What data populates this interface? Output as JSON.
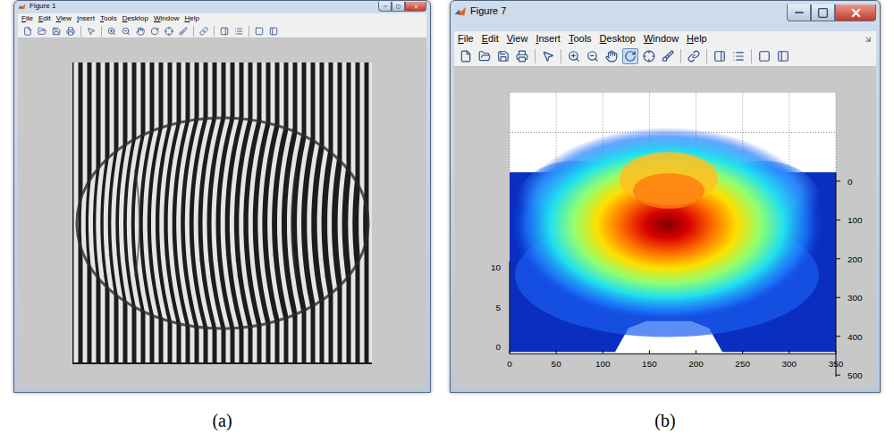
{
  "windows": [
    {
      "title": "Figure 1",
      "menu": [
        "File",
        "Edit",
        "View",
        "Insert",
        "Tools",
        "Desktop",
        "Window",
        "Help"
      ],
      "toolbar": [
        {
          "selected": false
        },
        {
          "selected": false
        },
        {
          "selected": false
        },
        {
          "selected": false
        },
        {
          "selected": false
        },
        {
          "selected": false
        },
        {
          "selected": false
        },
        {
          "selected": false
        },
        {
          "selected": false
        },
        {
          "selected": false
        },
        {
          "selected": false
        },
        {
          "selected": false
        },
        {
          "selected": false
        },
        {
          "selected": false
        },
        {
          "selected": false
        },
        {
          "selected": false
        }
      ],
      "content": {
        "kind": "image"
      },
      "caption": "(a)"
    },
    {
      "title": "Figure 7",
      "menu": [
        "File",
        "Edit",
        "View",
        "Insert",
        "Tools",
        "Desktop",
        "Window",
        "Help"
      ],
      "toolbar": [
        {
          "selected": false
        },
        {
          "selected": false
        },
        {
          "selected": false
        },
        {
          "selected": false
        },
        {
          "selected": false
        },
        {
          "selected": false
        },
        {
          "selected": false
        },
        {
          "selected": false
        },
        {
          "selected": true
        },
        {
          "selected": false
        },
        {
          "selected": false
        },
        {
          "selected": false
        },
        {
          "selected": false
        },
        {
          "selected": false
        },
        {
          "selected": false
        },
        {
          "selected": false
        }
      ],
      "content": {
        "kind": "surface",
        "z_ticks": [
          "0",
          "5",
          "10"
        ],
        "x_ticks": [
          "0",
          "50",
          "100",
          "150",
          "200",
          "250",
          "300",
          "350"
        ],
        "y_ticks": [
          "0",
          "100",
          "200",
          "300",
          "400",
          "500"
        ]
      },
      "caption": "(b)"
    }
  ]
}
